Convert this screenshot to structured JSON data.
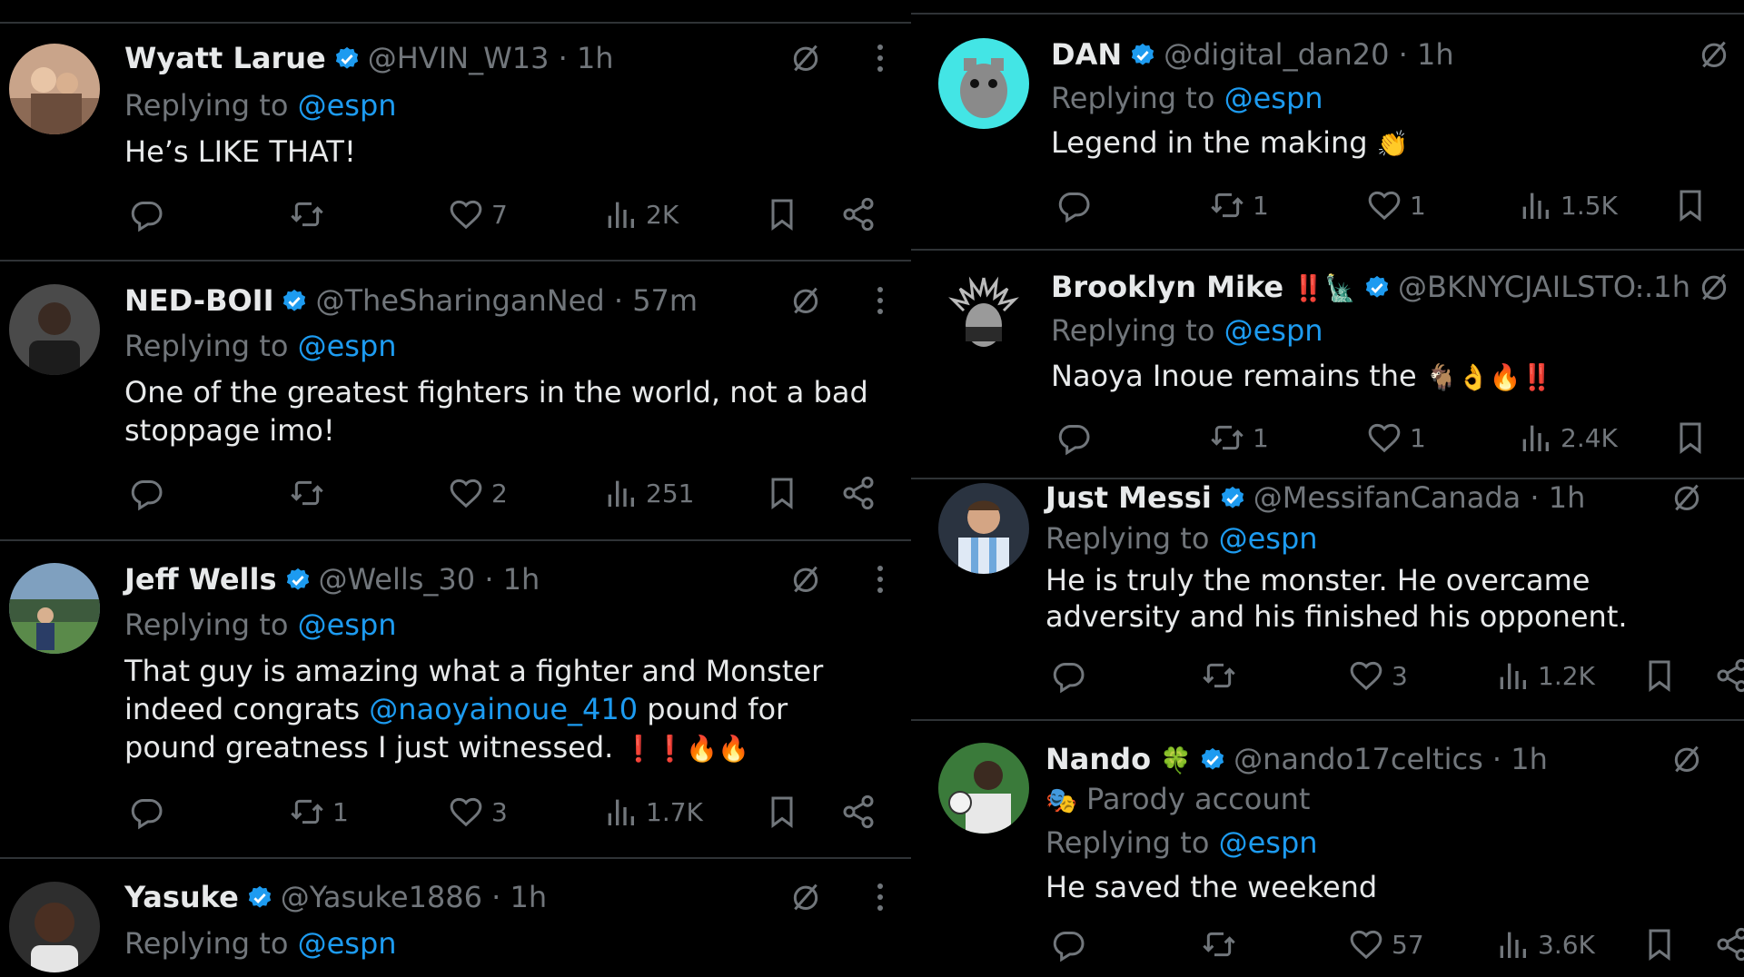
{
  "left_column": {
    "tweets": [
      {
        "name": "Wyatt Larue",
        "handle": "@HVIN_W13",
        "time": "· 1h",
        "replying_prefix": "Replying to",
        "replying_handle": "@espn",
        "body": "He’s LIKE THAT!",
        "likes": "7",
        "views": "2K"
      },
      {
        "name": "NED-BOII",
        "handle": "@TheSharinganNed",
        "time": "· 57m",
        "replying_prefix": "Replying to",
        "replying_handle": "@espn",
        "body": "One of the greatest fighters in the world, not a bad stoppage imo!",
        "likes": "2",
        "views": "251"
      },
      {
        "name": "Jeff Wells",
        "handle": "@Wells_30",
        "time": "· 1h",
        "replying_prefix": "Replying to",
        "replying_handle": "@espn",
        "body_part1": "That guy is amazing what a fighter and Monster indeed congrats",
        "body_mention": "@naoyainoue_410",
        "body_part2": "pound for pound greatness I just witnessed.",
        "body_emoji": "❗❗🔥🔥",
        "retweets": "1",
        "likes": "3",
        "views": "1.7K"
      },
      {
        "name": "Yasuke",
        "handle": "@Yasuke1886",
        "time": "· 1h",
        "replying_prefix": "Replying to",
        "replying_handle": "@espn"
      }
    ]
  },
  "right_column": {
    "tweets": [
      {
        "name": "DAN",
        "handle": "@digital_dan20",
        "time": "· 1h",
        "replying_prefix": "Replying to",
        "replying_handle": "@espn",
        "body": "Legend in the making",
        "body_emoji": "👏",
        "retweets": "1",
        "likes": "1",
        "views": "1.5K"
      },
      {
        "name": "Brooklyn Mike",
        "name_emoji": "‼️🗽",
        "handle": "@BKNYCJAILSTO...",
        "time": "· 1h",
        "replying_prefix": "Replying to",
        "replying_handle": "@espn",
        "body": "Naoya Inoue remains the",
        "body_emoji": "🐐👌🔥‼️",
        "retweets": "1",
        "likes": "1",
        "views": "2.4K"
      },
      {
        "name": "Just Messi",
        "handle": "@MessifanCanada",
        "time": "· 1h",
        "replying_prefix": "Replying to",
        "replying_handle": "@espn",
        "body": "He is truly the monster. He overcame adversity and his finished his opponent.",
        "likes": "3",
        "views": "1.2K"
      },
      {
        "name": "Nando",
        "name_emoji": "🍀",
        "handle": "@nando17celtics",
        "time": "· 1h",
        "parody_emoji": "🎭",
        "parody_label": "Parody account",
        "replying_prefix": "Replying to",
        "replying_handle": "@espn",
        "body": "He saved the weekend",
        "likes": "57",
        "views": "3.6K"
      }
    ]
  },
  "colors": {
    "background": "#000000",
    "text": "#e7e9ea",
    "muted": "#71767b",
    "link": "#1d9bf0",
    "divider": "#2f3336",
    "verified": "#1d9bf0"
  },
  "icons": [
    "reply-icon",
    "retweet-icon",
    "like-icon",
    "views-icon",
    "bookmark-icon",
    "share-icon",
    "grok-icon",
    "more-icon",
    "verified-badge"
  ]
}
